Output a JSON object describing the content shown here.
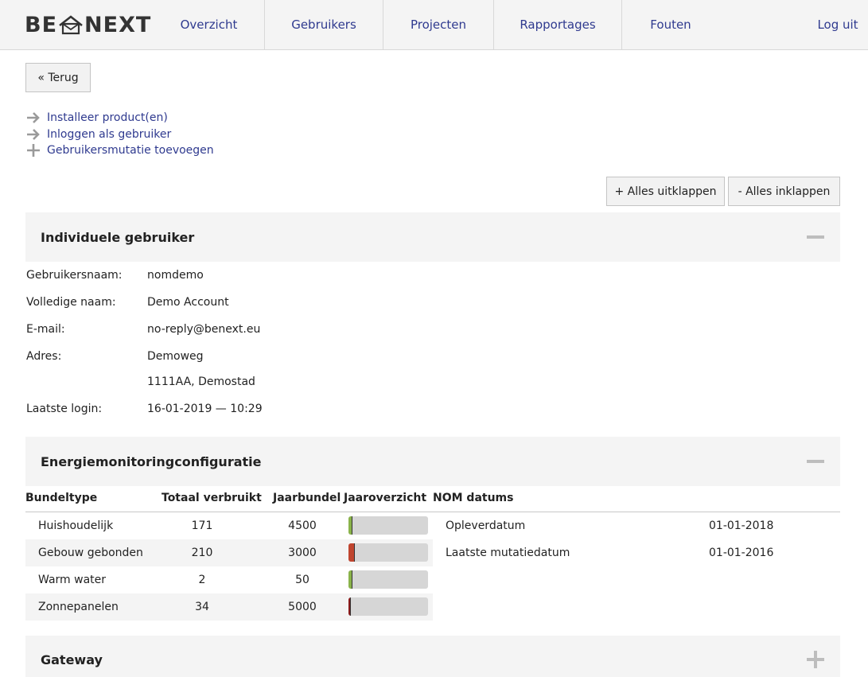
{
  "header": {
    "logo_left": "BE",
    "logo_right": "NEXT",
    "nav": [
      {
        "label": "Overzicht"
      },
      {
        "label": "Gebruikers"
      },
      {
        "label": "Projecten"
      },
      {
        "label": "Rapportages"
      },
      {
        "label": "Fouten"
      }
    ],
    "logout": "Log uit"
  },
  "back_button": "« Terug",
  "actions": [
    {
      "label": "Installeer product(en)",
      "icon": "arrow-right-icon"
    },
    {
      "label": "Inloggen als gebruiker",
      "icon": "arrow-right-icon"
    },
    {
      "label": "Gebruikersmutatie toevoegen",
      "icon": "plus-icon"
    }
  ],
  "expand_all": "+ Alles uitklappen",
  "collapse_all": "- Alles inklappen",
  "sections": {
    "user": {
      "title": "Individuele gebruiker",
      "fields": [
        {
          "label": "Gebruikersnaam:",
          "value": "nomdemo"
        },
        {
          "label": "Volledige naam:",
          "value": "Demo Account"
        },
        {
          "label": "E-mail:",
          "value": "no-reply@benext.eu"
        },
        {
          "label": "Adres:",
          "value": "Demoweg"
        },
        {
          "label": "",
          "value": "1111AA, Demostad"
        },
        {
          "label": "Laatste login:",
          "value": "16-01-2019 — 10:29"
        }
      ]
    },
    "energy": {
      "title": "Energiemonitoringconfiguratie",
      "columns": [
        "Bundeltype",
        "Totaal verbruikt",
        "Jaarbundel",
        "Jaaroverzicht",
        "NOM datums"
      ],
      "rows": [
        {
          "type": "Huishoudelijk",
          "used": "171",
          "bundle": "4500",
          "fraction": 0.038,
          "color": "#8ab34a"
        },
        {
          "type": "Gebouw gebonden",
          "used": "210",
          "bundle": "3000",
          "fraction": 0.07,
          "color": "#c0452f"
        },
        {
          "type": "Warm water",
          "used": "2",
          "bundle": "50",
          "fraction": 0.04,
          "color": "#8ab34a"
        },
        {
          "type": "Zonnepanelen",
          "used": "34",
          "bundle": "5000",
          "fraction": 0.007,
          "color": "#8b1a1a"
        }
      ],
      "nom_dates": [
        {
          "label": "Opleverdatum",
          "value": "01-01-2018"
        },
        {
          "label": "Laatste mutatiedatum",
          "value": "01-01-2016"
        }
      ]
    },
    "gateway": {
      "title": "Gateway"
    }
  }
}
